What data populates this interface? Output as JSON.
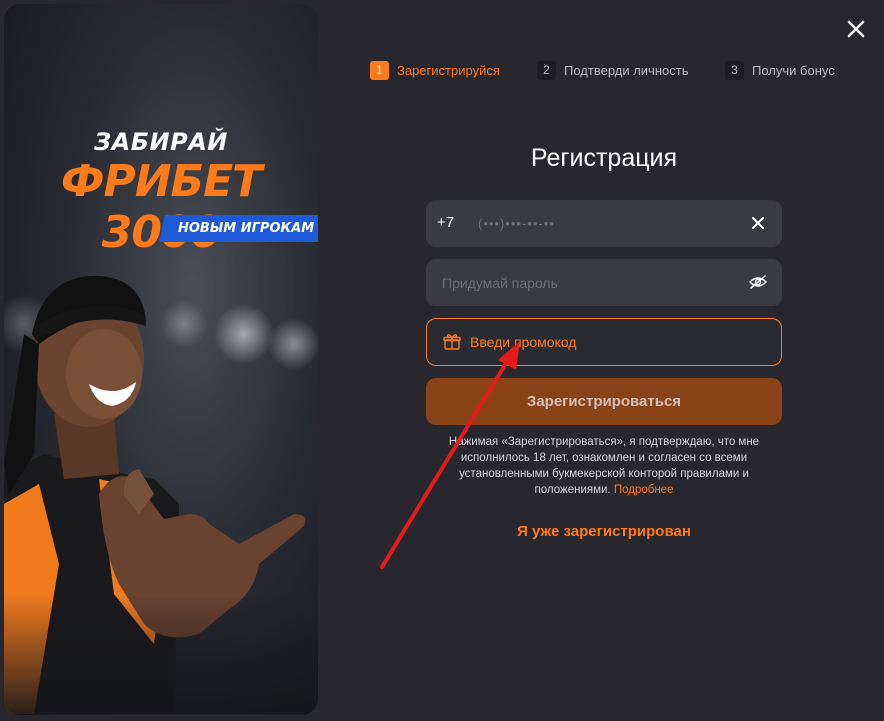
{
  "banner": {
    "title_line1": "ЗАБИРАЙ",
    "title_line2": "ФРИБЕТ 3000",
    "tag": "НОВЫМ ИГРОКАМ"
  },
  "steps": [
    {
      "num": "1",
      "label": "Зарегистрируйся",
      "active": true
    },
    {
      "num": "2",
      "label": "Подтверди личность",
      "active": false
    },
    {
      "num": "3",
      "label": "Получи бонус",
      "active": false
    }
  ],
  "form": {
    "title": "Регистрация",
    "phone_prefix": "+7",
    "phone_placeholder": "(•••)•••-••-••",
    "password_placeholder": "Придумай пароль",
    "promo_label": "Введи промокод",
    "submit_label": "Зарегистрироваться",
    "terms_text": "Нажимая «Зарегистрироваться», я подтверждаю, что мне исполнилось 18 лет, ознакомлен и согласен со всеми установленными букмекерской конторой правилами и положениями.",
    "terms_link": "Подробнее",
    "login_link": "Я уже зарегистрирован"
  },
  "colors": {
    "accent": "#ff7a1a",
    "background": "#27272d",
    "field": "#3a3a43",
    "submit": "#8a4218",
    "tag": "#1f5bd6",
    "annotation_arrow": "#e31b1b"
  },
  "icons": [
    "close-icon",
    "clear-icon",
    "eye-off-icon",
    "gift-icon"
  ]
}
